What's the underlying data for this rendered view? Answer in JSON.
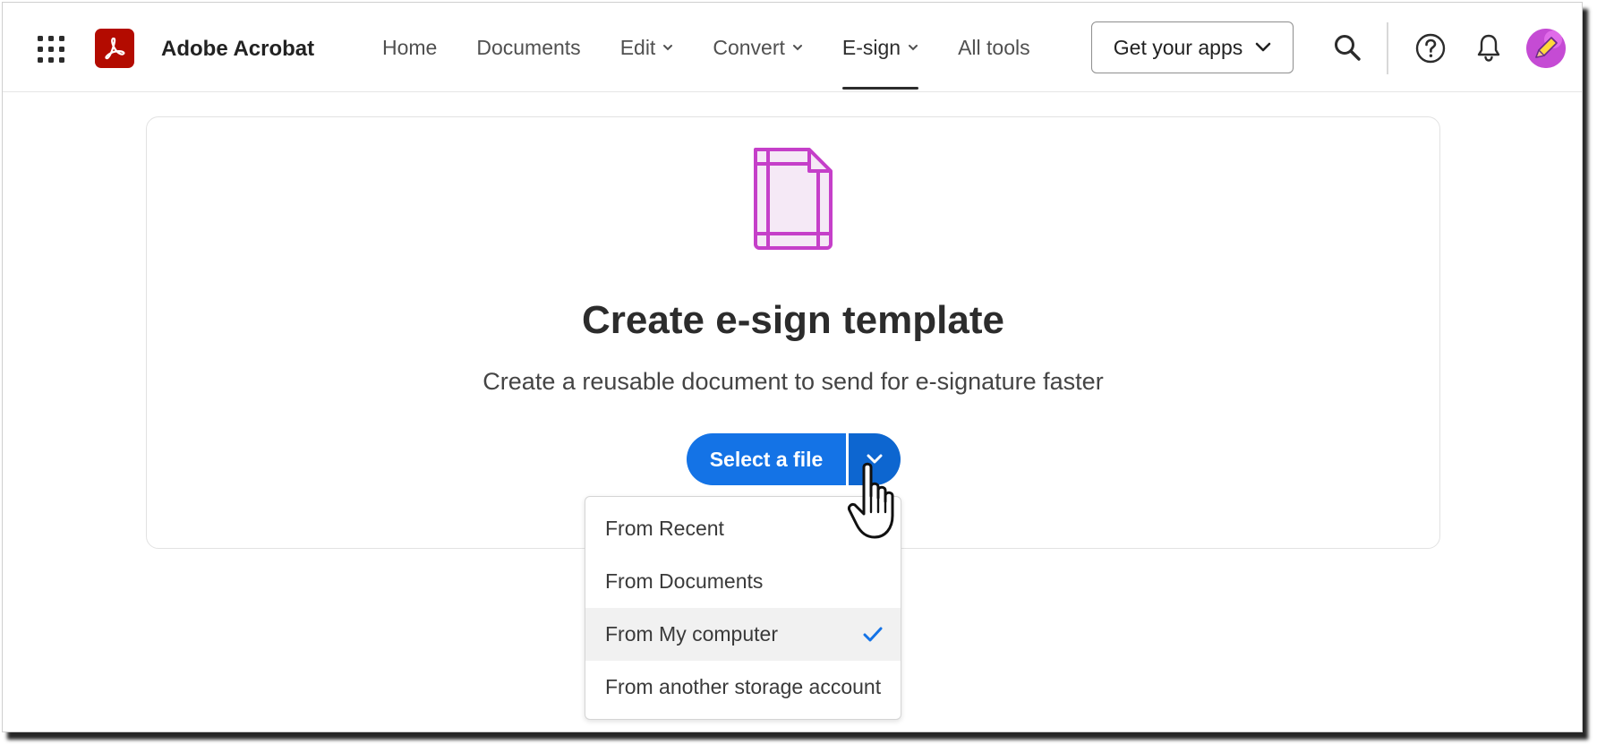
{
  "header": {
    "brand": "Adobe Acrobat",
    "nav": [
      {
        "label": "Home",
        "has_menu": false,
        "active": false
      },
      {
        "label": "Documents",
        "has_menu": false,
        "active": false
      },
      {
        "label": "Edit",
        "has_menu": true,
        "active": false
      },
      {
        "label": "Convert",
        "has_menu": true,
        "active": false
      },
      {
        "label": "E-sign",
        "has_menu": true,
        "active": true
      },
      {
        "label": "All tools",
        "has_menu": false,
        "active": false
      }
    ],
    "apps_button_label": "Get your apps",
    "icons": [
      "apps-grid-icon",
      "acrobat-logo-icon",
      "search-icon",
      "help-icon",
      "bell-icon",
      "avatar"
    ]
  },
  "card": {
    "icon": "document-template-icon",
    "title": "Create e-sign template",
    "subtitle": "Create a reusable document to send for e-signature faster",
    "select_button_label": "Select a file"
  },
  "menu": {
    "items": [
      {
        "label": "From Recent",
        "selected": false
      },
      {
        "label": "From Documents",
        "selected": false
      },
      {
        "label": "From My computer",
        "selected": true
      },
      {
        "label": "From another storage account",
        "selected": false
      }
    ]
  },
  "colors": {
    "accent": "#1473e6",
    "logo": "#b30b00",
    "doc_icon": "#c53fc9"
  }
}
